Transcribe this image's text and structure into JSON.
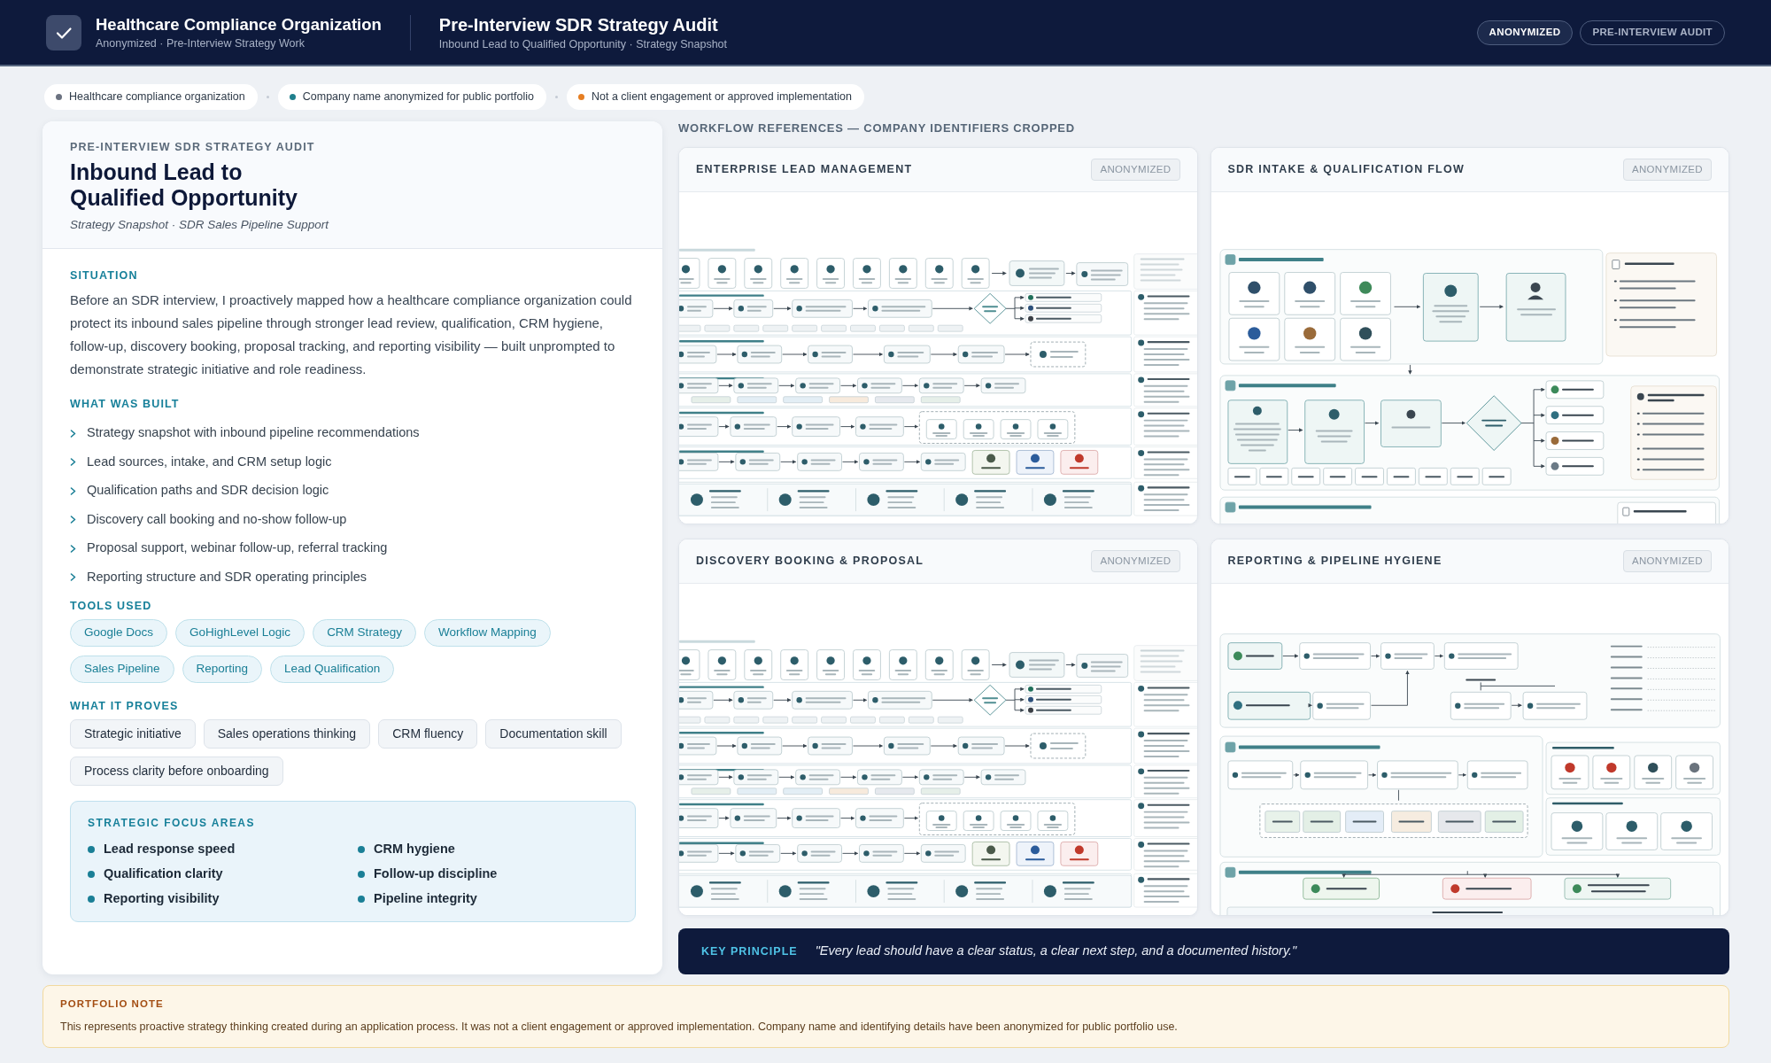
{
  "top_bar": {
    "title": "Healthcare Compliance Organization",
    "subtitle": "Anonymized · Pre-Interview Strategy Work",
    "page_title": "Pre-Interview SDR Strategy Audit",
    "page_subtitle": "Inbound Lead to Qualified Opportunity · Strategy Snapshot",
    "badges": [
      {
        "label": "ANONYMIZED",
        "kind": "strong"
      },
      {
        "label": "PRE-INTERVIEW AUDIT",
        "kind": "muted"
      }
    ]
  },
  "notice_chips": [
    {
      "label": "Healthcare compliance organization",
      "color": "#6b7280"
    },
    {
      "label": "Company name anonymized for public portfolio",
      "color": "#1f7f8c"
    },
    {
      "label": "Not a client engagement or approved implementation",
      "color": "#e67e22"
    }
  ],
  "summary": {
    "eyebrow": "PRE-INTERVIEW SDR STRATEGY AUDIT",
    "title_lines": [
      "Inbound Lead to",
      "Qualified Opportunity"
    ],
    "subtitle": "Strategy Snapshot · SDR Sales Pipeline Support",
    "situation": {
      "heading": "SITUATION",
      "text": "Before an SDR interview, I proactively mapped how a healthcare compliance organization could protect its inbound sales pipeline through stronger lead review, qualification, CRM hygiene, follow-up, discovery booking, proposal tracking, and reporting visibility — built unprompted to demonstrate strategic initiative and role readiness."
    },
    "what_was_built": {
      "heading": "WHAT WAS BUILT",
      "items": [
        "Strategy snapshot with inbound pipeline recommendations",
        "Lead sources, intake, and CRM setup logic",
        "Qualification paths and SDR decision logic",
        "Discovery call booking and no-show follow-up",
        "Proposal support, webinar follow-up, referral tracking",
        "Reporting structure and SDR operating principles"
      ]
    },
    "tools_used": {
      "heading": "TOOLS USED",
      "tags": [
        "Google Docs",
        "GoHighLevel Logic",
        "CRM Strategy",
        "Workflow Mapping",
        "Sales Pipeline",
        "Reporting",
        "Lead Qualification"
      ]
    },
    "what_it_proves": {
      "heading": "WHAT IT PROVES",
      "tags": [
        "Strategic initiative",
        "Sales operations thinking",
        "CRM fluency",
        "Documentation skill",
        "Process clarity before onboarding"
      ]
    },
    "focus_areas": {
      "heading": "STRATEGIC FOCUS AREAS",
      "items": [
        "Lead response speed",
        "CRM hygiene",
        "Qualification clarity",
        "Follow-up discipline",
        "Reporting visibility",
        "Pipeline integrity"
      ]
    }
  },
  "workflow_references": {
    "heading": "WORKFLOW REFERENCES — COMPANY IDENTIFIERS CROPPED",
    "panels": [
      {
        "title": "ENTERPRISE LEAD MANAGEMENT",
        "badge": "ANONYMIZED",
        "kind": "swimlane"
      },
      {
        "title": "SDR INTAKE & QUALIFICATION FLOW",
        "badge": "ANONYMIZED",
        "kind": "intake"
      },
      {
        "title": "DISCOVERY BOOKING & PROPOSAL",
        "badge": "ANONYMIZED",
        "kind": "swimlane"
      },
      {
        "title": "REPORTING & PIPELINE HYGIENE",
        "badge": "ANONYMIZED",
        "kind": "hygiene"
      }
    ]
  },
  "key_principle": {
    "label": "KEY PRINCIPLE",
    "quote": "\"Every lead should have a clear status, a clear next step, and a documented history.\""
  },
  "portfolio_note": {
    "label": "PORTFOLIO NOTE",
    "text": "This represents proactive strategy thinking created during an application process. It was not a client engagement or approved implementation. Company name and identifying details have been anonymized for public portfolio use."
  }
}
